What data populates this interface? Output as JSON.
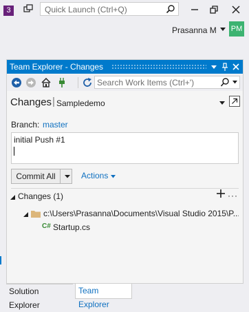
{
  "titlebar": {
    "badge": "3",
    "quick_launch_placeholder": "Quick Launch (Ctrl+Q)",
    "user_name": "Prasanna M",
    "avatar_initials": "PM",
    "avatar_color": "#3cb371",
    "accent_color": "#68217a"
  },
  "panel": {
    "title": "Team Explorer - Changes",
    "title_color": "#007acc",
    "title_buttons": [
      "dropdown",
      "pin",
      "close"
    ],
    "toolbar": {
      "icons": [
        "back-icon",
        "forward-icon",
        "home-icon",
        "connect-icon",
        "refresh-icon"
      ],
      "search_placeholder": "Search Work Items (Ctrl+')"
    },
    "header": {
      "title": "Changes",
      "separator": "|",
      "repo": "Sampledemo"
    },
    "branch": {
      "label": "Branch:",
      "value": "master"
    },
    "commit_message": "initial Push #1",
    "commit_button": "Commit All",
    "actions_label": "Actions",
    "changes_section": {
      "label": "Changes (1)",
      "folder_path": "c:\\Users\\Prasanna\\Documents\\Visual Studio 2015\\P...",
      "file_icon": "C#",
      "file_name": "Startup.cs"
    }
  },
  "bottom_tabs": [
    {
      "label": "Solution Explorer",
      "active": false
    },
    {
      "label": "Team Explorer",
      "active": true
    }
  ]
}
